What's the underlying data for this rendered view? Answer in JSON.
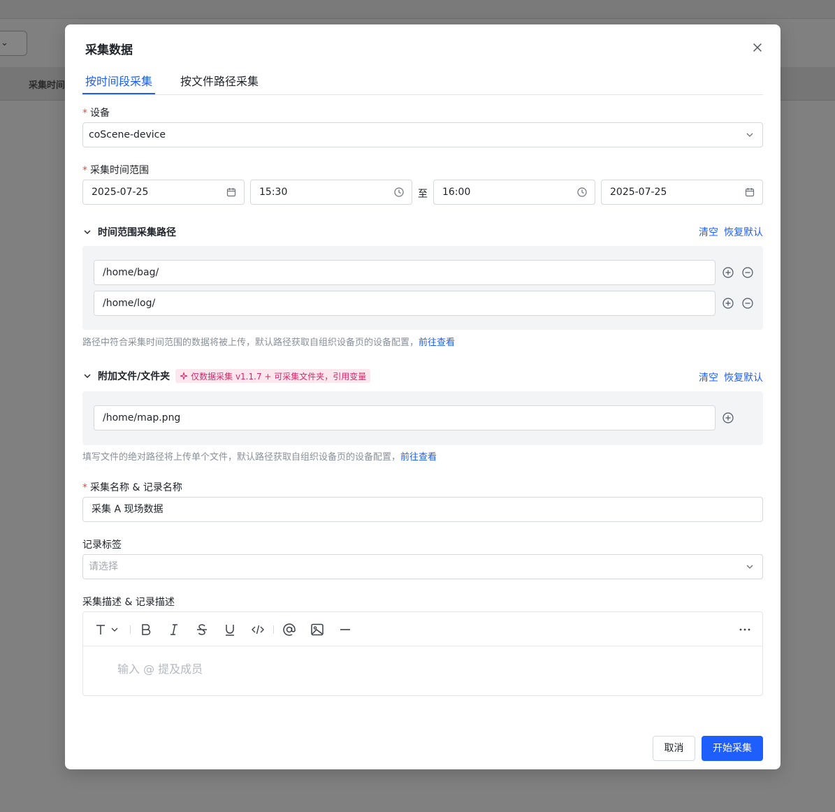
{
  "background": {
    "select_label": "⌄",
    "column_header": "采集时间"
  },
  "modal": {
    "title": "采集数据",
    "tabs": [
      {
        "label": "按时间段采集",
        "active": true
      },
      {
        "label": "按文件路径采集",
        "active": false
      }
    ],
    "device": {
      "label": "设备",
      "value": "coScene-device"
    },
    "time_range": {
      "label": "采集时间范围",
      "start_date": "2025-07-25",
      "start_time": "15:30",
      "separator": "至",
      "end_time": "16:00",
      "end_date": "2025-07-25"
    },
    "time_paths": {
      "title": "时间范围采集路径",
      "clear": "清空",
      "reset": "恢复默认",
      "paths": [
        "/home/bag/",
        "/home/log/"
      ],
      "help": "路径中符合采集时间范围的数据将被上传，默认路径获取自组织设备页的设备配置，",
      "help_link": "前往查看"
    },
    "extra_files": {
      "title": "附加文件/文件夹",
      "tag": "仅数据采集 v1.1.7 + 可采集文件夹，引用变量",
      "clear": "清空",
      "reset": "恢复默认",
      "paths": [
        "/home/map.png"
      ],
      "help": "填写文件的绝对路径将上传单个文件，默认路径获取自组织设备页的设备配置，",
      "help_link": "前往查看"
    },
    "record_name": {
      "label": "采集名称 & 记录名称",
      "value": "采集 A 现场数据"
    },
    "record_tags": {
      "label": "记录标签",
      "placeholder": "请选择"
    },
    "description": {
      "label": "采集描述 & 记录描述",
      "placeholder": "输入 @ 提及成员"
    },
    "buttons": {
      "cancel": "取消",
      "start": "开始采集"
    }
  },
  "colors": {
    "primary": "#1d5efc",
    "required": "#f0443c",
    "tag_bg": "#fde7ef",
    "tag_text": "#d6286b"
  }
}
